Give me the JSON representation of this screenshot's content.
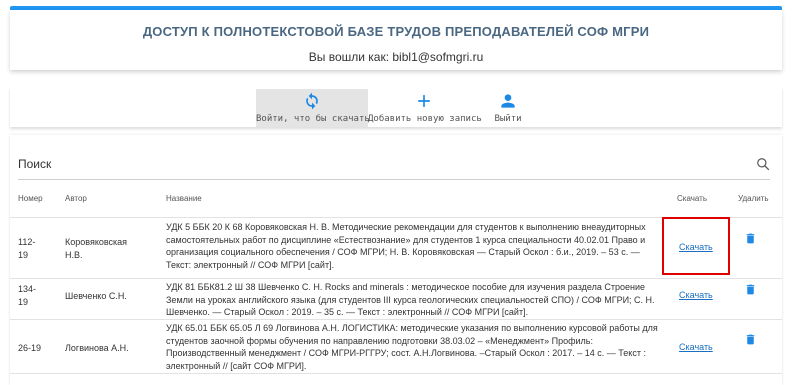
{
  "header": {
    "title": "ДОСТУП К ПОЛНОТЕКСТОВОЙ БАЗЕ ТРУДОВ ПРЕПОДАВАТЕЛЕЙ СОФ МГРИ",
    "logged_in": "Вы вошли как: bibl1@sofmgri.ru"
  },
  "toolbar": {
    "buttons": [
      {
        "label": "Войти, что бы скачать",
        "icon": "refresh-icon",
        "active": true
      },
      {
        "label": "Добавить новую запись",
        "icon": "plus-icon",
        "active": false
      },
      {
        "label": "Выйти",
        "icon": "person-icon",
        "active": false
      }
    ]
  },
  "search": {
    "placeholder": "Поиск",
    "icon": "search-icon"
  },
  "table": {
    "columns": [
      "Номер",
      "Автор",
      "Название",
      "Скачать",
      "Удалить"
    ],
    "rows": [
      {
        "number": "112-\n19",
        "author": "Коровяковская\nН.В.",
        "title": "УДК 5 ББК 20 К 68 Коровяковская Н. В. Методические рекомендации для студентов к выполнению внеаудиторных самостоятельных работ по дисциплине «Естествознание» для студентов 1 курса специальности 40.02.01 Право и организация социального обеспечения / СОФ МГРИ; Н. В. Коровяковская — Старый Оскол : б.и., 2019. – 53 с. — Текст: электронный // СОФ МГРИ [сайт].",
        "download": "Скачать"
      },
      {
        "number": "134-\n19",
        "author": "Шевченко С.Н.",
        "title": "УДК 81 ББК81.2 Ш 38 Шевченко С. Н. Rocks and minerals : методическое пособие для изучения раздела Строение Земли на уроках английского языка (для студентов III курса геологических специальностей СПО) / СОФ МГРИ; С. Н. Шевченко. — Старый Оскол : 2019. – 35 с. — Текст : электронный // СОФ МГРИ [сайт].",
        "download": "Скачать"
      },
      {
        "number": "26-19",
        "author": "Логвинова А.Н.",
        "title": "УДК 65.01 ББК 65.05 Л 69 Логвинова А.Н. ЛОГИСТИКА: методические указания по выполнению курсовой работы для студентов заочной формы обучения по направлению подготовки 38.03.02 – «Менеджмент» Профиль: Производственный менеджмент / СОФ МГРИ-РГГРУ; сост. А.Н.Логвинова. –Старый Оскол : 2017. – 14 с. — Текст : электронный // [сайт СОФ МГРИ].",
        "download": "Скачать"
      }
    ]
  },
  "colors": {
    "accent": "#2196f3",
    "link": "#1a6fc0",
    "highlight": "#e00000",
    "title": "#4a6782"
  }
}
